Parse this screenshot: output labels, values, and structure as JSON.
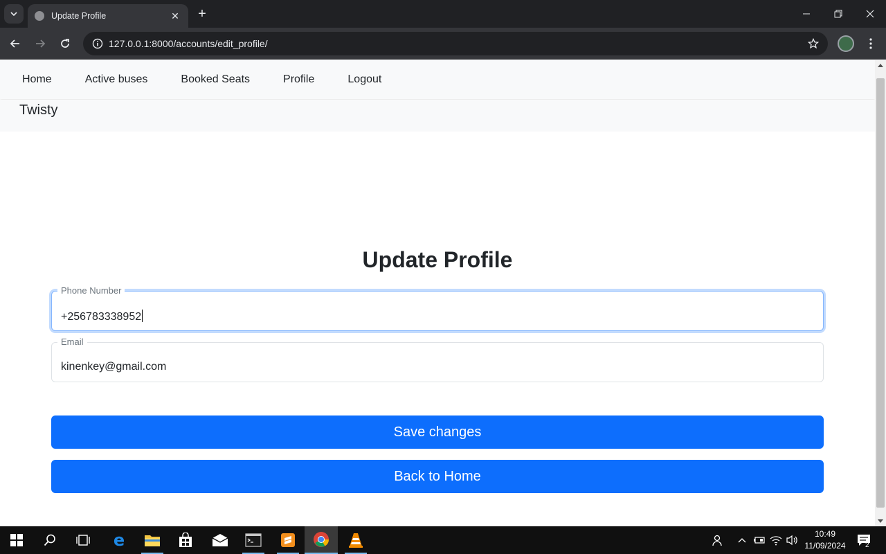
{
  "browser": {
    "tab_title": "Update Profile",
    "new_tab": "+",
    "url": "127.0.0.1:8000/accounts/edit_profile/"
  },
  "nav": {
    "links": [
      "Home",
      "Active buses",
      "Booked Seats",
      "Profile",
      "Logout"
    ],
    "brand": "Twisty"
  },
  "form": {
    "title": "Update Profile",
    "phone": {
      "label": "Phone Number",
      "value": "+256783338952"
    },
    "email": {
      "label": "Email",
      "value": "kinenkey@gmail.com"
    },
    "save_label": "Save changes",
    "back_label": "Back to Home"
  },
  "taskbar": {
    "time": "10:49",
    "date": "11/09/2024",
    "notifications": "2"
  },
  "colors": {
    "primary": "#0d6efd",
    "navbar_bg": "#f8f9fa",
    "chrome_dark": "#202124",
    "chrome_toolbar": "#35363a"
  }
}
